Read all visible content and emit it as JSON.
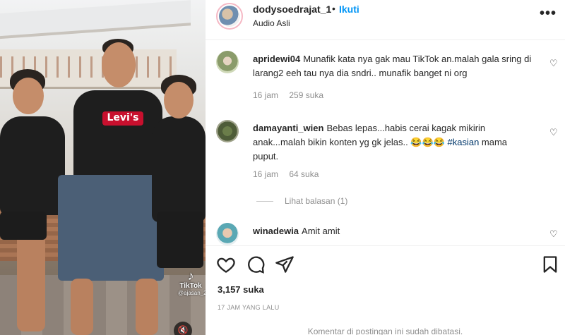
{
  "post": {
    "username": "dodysoedrajat_1",
    "separator": "•",
    "follow_label": "Ikuti",
    "audio_label": "Audio Asli",
    "more_icon": "more-options-icon"
  },
  "video": {
    "watermark_brand": "TikTok",
    "watermark_user": "@ajasan_2",
    "shirt_logo": "Levi's"
  },
  "comments": [
    {
      "username": "apridewi04",
      "text": "Munafik kata nya gak mau TikTok an.malah gala sring di larang2 eeh tau nya dia sndri.. munafik banget ni org",
      "time": "16 jam",
      "likes": "259 suka"
    },
    {
      "username": "damayanti_wien",
      "text": "Bebas lepas...habis cerai kagak mikirin anak...malah bikin konten yg gk jelas.. 😂😂😂",
      "hashtag": "#kasian",
      "text_after": "mama puput.",
      "time": "16 jam",
      "likes": "64 suka",
      "replies_label": "Lihat balasan (1)"
    },
    {
      "username": "winadewia",
      "text": "Amit amit"
    }
  ],
  "actions": {
    "likes_count": "3,157 suka",
    "time_ago": "17 JAM YANG LALU",
    "comments_disabled": "Komentar di postingan ini sudah dibatasi."
  }
}
